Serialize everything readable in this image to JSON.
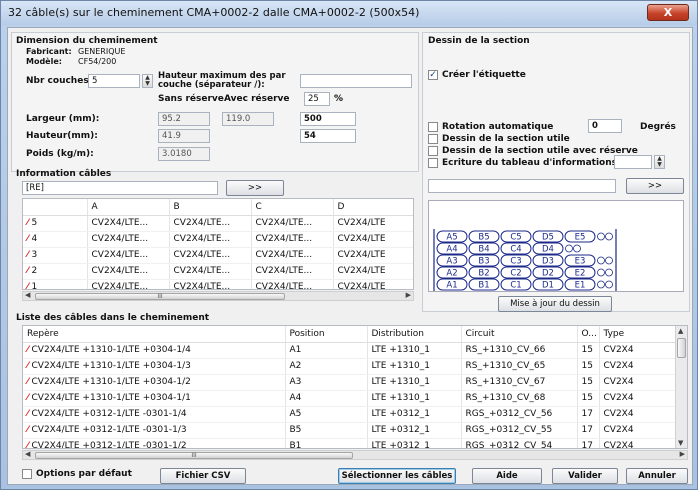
{
  "window": {
    "title": "32 câble(s) sur le cheminement CMA+0002-2 dalle CMA+0002-2 (500x54)",
    "close_label": "X"
  },
  "dimension": {
    "header": "Dimension du cheminement",
    "fabricant_label": "Fabricant:",
    "fabricant_value": "GENERIQUE",
    "modele_label": "Modèle:",
    "modele_value": "CF54/200",
    "nbr_couches_label": "Nbr couches:",
    "nbr_couches_value": "5",
    "hauteur_max_label": "Hauteur maximum des par couche (séparateur /):",
    "hauteur_max_value": "",
    "sans_reserve_label": "Sans réserve",
    "avec_reserve_label": "Avec réserve",
    "reserve_pct_value": "25",
    "pct_label": "%",
    "largeur_label": "Largeur (mm):",
    "largeur_sans": "95.2",
    "largeur_avec": "119.0",
    "largeur_value": "500",
    "hauteur_label": "Hauteur(mm):",
    "hauteur_sans": "41.9",
    "hauteur_value": "54",
    "poids_label": "Poids (kg/m):",
    "poids_value": "3.0180"
  },
  "section": {
    "header": "Dessin de la section",
    "creer_etiquette_label": "Créer l'étiquette",
    "creer_etiquette_checked": "✓",
    "rotation_label": "Rotation automatique",
    "rotation_value": "0",
    "degres_label": "Degrés",
    "dessin_utile_label": "Dessin de la section utile",
    "dessin_utile_reserve_label": "Dessin de la section utile avec réserve",
    "ecriture_label": "Ecriture du tableau d'informations",
    "ecriture_value": "",
    "filter_value": "",
    "filter_button": ">>",
    "update_button": "Mise à jour du dessin",
    "drawing_rows": [
      [
        "A5",
        "B5",
        "C5",
        "D5",
        "E5"
      ],
      [
        "A4",
        "B4",
        "C4",
        "D4"
      ],
      [
        "A3",
        "B3",
        "C3",
        "D3",
        "E3"
      ],
      [
        "A2",
        "B2",
        "C2",
        "D2",
        "E2"
      ],
      [
        "A1",
        "B1",
        "C1",
        "D1",
        "E1"
      ]
    ]
  },
  "info_cables": {
    "header": "Information câbles",
    "filter_value": "[RE]",
    "filter_button": ">>",
    "columns": [
      "",
      "A",
      "B",
      "C",
      "D"
    ],
    "rows": [
      {
        "layer": "5",
        "cells": [
          "CV2X4/LTE...",
          "CV2X4/LTE...",
          "CV2X4/LTE...",
          "CV2X4/LTE"
        ]
      },
      {
        "layer": "4",
        "cells": [
          "CV2X4/LTE...",
          "CV2X4/LTE...",
          "CV2X4/LTE...",
          "CV2X4/LTE"
        ]
      },
      {
        "layer": "3",
        "cells": [
          "CV2X4/LTE...",
          "CV2X4/LTE...",
          "CV2X4/LTE...",
          "CV2X4/LTE"
        ]
      },
      {
        "layer": "2",
        "cells": [
          "CV2X4/LTE...",
          "CV2X4/LTE...",
          "CV2X4/LTE...",
          "CV2X4/LTE"
        ]
      },
      {
        "layer": "1",
        "cells": [
          "CV2X4/LTE...",
          "CV2X4/LTE...",
          "CV2X4/LTE...",
          "CV2X4/LTE"
        ]
      }
    ]
  },
  "cable_list": {
    "header": "Liste des câbles dans le cheminement",
    "columns": [
      "Repère",
      "Position",
      "Distribution",
      "Circuit",
      "O...",
      "Type"
    ],
    "rows": [
      [
        "CV2X4/LTE +1310-1/LTE +0304-1/4",
        "A1",
        "LTE +1310_1",
        "RS_+1310_CV_66",
        "15",
        "CV2X4"
      ],
      [
        "CV2X4/LTE +1310-1/LTE +0304-1/3",
        "A2",
        "LTE +1310_1",
        "RS_+1310_CV_65",
        "15",
        "CV2X4"
      ],
      [
        "CV2X4/LTE +1310-1/LTE +0304-1/2",
        "A3",
        "LTE +1310_1",
        "RS_+1310_CV_67",
        "15",
        "CV2X4"
      ],
      [
        "CV2X4/LTE +1310-1/LTE +0304-1/1",
        "A4",
        "LTE +1310_1",
        "RS_+1310_CV_68",
        "15",
        "CV2X4"
      ],
      [
        "CV2X4/LTE +0312-1/LTE -0301-1/4",
        "A5",
        "LTE +0312_1",
        "RGS_+0312_CV_56",
        "17",
        "CV2X4"
      ],
      [
        "CV2X4/LTE +0312-1/LTE -0301-1/3",
        "B5",
        "LTE +0312_1",
        "RGS_+0312_CV_55",
        "17",
        "CV2X4"
      ],
      [
        "CV2X4/LTE +0312-1/LTE -0301-1/2",
        "B1",
        "LTE +0312_1",
        "RGS_+0312_CV_54",
        "17",
        "CV2X4"
      ]
    ]
  },
  "footer": {
    "options_label": "Options par défaut",
    "csv_button": "Fichier CSV",
    "select_button": "Sélectionner les câbles",
    "aide_button": "Aide",
    "valider_button": "Valider",
    "annuler_button": "Annuler"
  },
  "scrollbar_grip": "III"
}
